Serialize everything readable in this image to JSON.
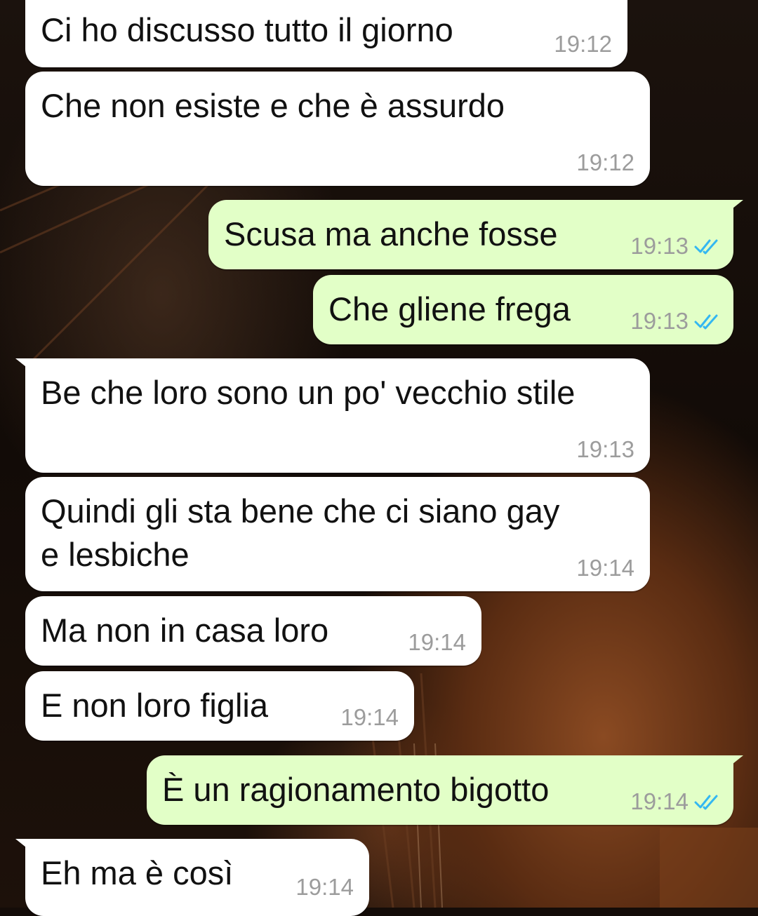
{
  "messages": [
    {
      "text": "Ci ho discusso tutto il giorno",
      "time": "19:12",
      "direction": "in",
      "status": ""
    },
    {
      "text": "Che non esiste e che è assurdo",
      "time": "19:12",
      "direction": "in",
      "status": ""
    },
    {
      "text": "Scusa ma anche fosse",
      "time": "19:13",
      "direction": "out",
      "status": "read"
    },
    {
      "text": "Che gliene frega",
      "time": "19:13",
      "direction": "out",
      "status": "read"
    },
    {
      "text": "Be che loro sono un po' vecchio stile",
      "time": "19:13",
      "direction": "in",
      "status": ""
    },
    {
      "text_line1": "Quindi gli sta bene che ci siano gay",
      "text_line2": "e lesbiche",
      "time": "19:14",
      "direction": "in",
      "status": ""
    },
    {
      "text": "Ma non in casa loro",
      "time": "19:14",
      "direction": "in",
      "status": ""
    },
    {
      "text": "E non loro figlia",
      "time": "19:14",
      "direction": "in",
      "status": ""
    },
    {
      "text": "È un ragionamento bigotto",
      "time": "19:14",
      "direction": "out",
      "status": "read"
    },
    {
      "text": "Eh ma è così",
      "time": "19:14",
      "direction": "in",
      "status": ""
    }
  ],
  "colors": {
    "incoming_bubble": "#ffffff",
    "outgoing_bubble": "#e2ffc7",
    "read_ticks": "#34b7f1",
    "timestamp": "#9c9c9c"
  },
  "icons": {
    "read_receipt": "double-check-icon"
  }
}
